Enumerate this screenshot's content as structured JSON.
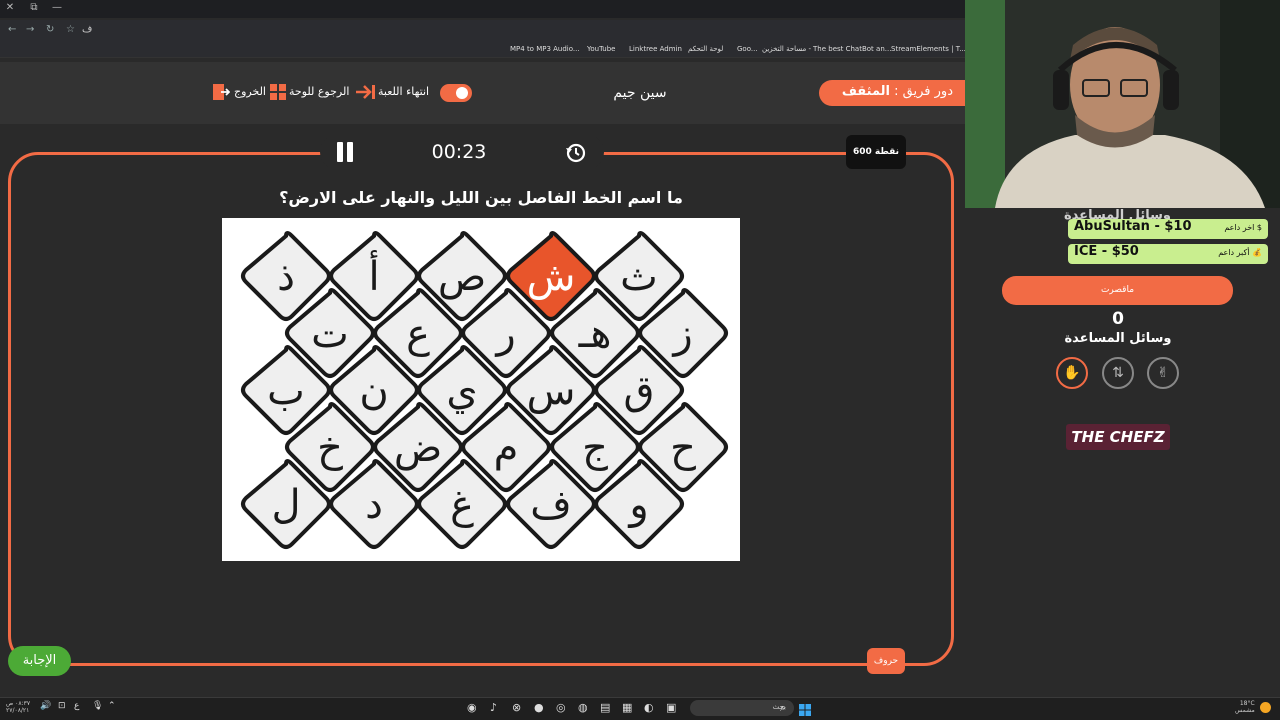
{
  "browser": {
    "address": "ف",
    "bookmarks": [
      "MP4 to MP3 Audio...",
      "YouTube",
      "Linktree Admin",
      "لوحة التحكم",
      "Goo...",
      "مساحة التخزين -",
      "The best ChatBot an...",
      "StreamElements | T..."
    ]
  },
  "header": {
    "team_label": "دور فريق :",
    "team_name": "المثقف",
    "game_title": "سين جيم",
    "end_game": "انتهاء اللعبة",
    "back_to_board": "الرجوع للوحة",
    "exit": "الخروج"
  },
  "game": {
    "timer": "00:23",
    "points": "600 نقطة",
    "question": "ما اسم الخط الفاصل بين الليل والنهار على الارض؟",
    "letters_button": "حروف",
    "answer_button": "الإجابة",
    "board": {
      "highlight_color": "#e8552b",
      "rows": [
        [
          "ث",
          "ش",
          "ص",
          "أ",
          "ذ"
        ],
        [
          "ز",
          "هـ",
          "ر",
          "ع",
          "ت"
        ],
        [
          "ق",
          "س",
          "ي",
          "ن",
          "ب"
        ],
        [
          "ح",
          "ج",
          "م",
          "ض",
          "خ"
        ],
        [
          "و",
          "ف",
          "غ",
          "د",
          "ل"
        ]
      ],
      "highlighted": "ش"
    }
  },
  "sidebar": {
    "faded_title": "وسائل المساعدة",
    "last_supporter_label": "$ اخر داعم",
    "last_supporter": "AbuSultan - $10",
    "top_supporter_label": "💰 أكبر داعم",
    "top_supporter": "ICE - $50",
    "missed_button": "ماقصرت",
    "count": "0",
    "aids_title": "وسائل المساعدة",
    "logo": "THE CHEFZ"
  },
  "taskbar": {
    "search_placeholder": "بحث",
    "weather": "18°C",
    "weather_desc": "مشمس",
    "time": "٠٨:٣٧ ص",
    "date": "٢٧/٠٨/٢١",
    "lang": "ع"
  },
  "colors": {
    "accent": "#f26b45",
    "green": "#4caa36",
    "support": "#c9ee8f"
  }
}
